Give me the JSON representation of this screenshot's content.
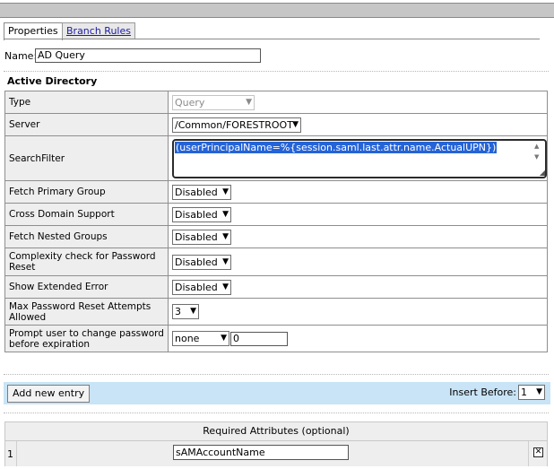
{
  "tabs": [
    {
      "label": "Properties"
    },
    {
      "label": "Branch Rules"
    }
  ],
  "name_label": "Name:",
  "name_value": "AD Query",
  "section_title": "Active Directory",
  "rows": {
    "type": {
      "label": "Type",
      "value": "Query"
    },
    "server": {
      "label": "Server",
      "value": "/Common/FORESTROOT"
    },
    "search_filter": {
      "label": "SearchFilter",
      "value": "(userPrincipalName=%{session.saml.last.attr.name.ActualUPN})"
    },
    "fetch_primary_group": {
      "label": "Fetch Primary Group",
      "value": "Disabled"
    },
    "cross_domain_support": {
      "label": "Cross Domain Support",
      "value": "Disabled"
    },
    "fetch_nested_groups": {
      "label": "Fetch Nested Groups",
      "value": "Disabled"
    },
    "complexity_check": {
      "label": "Complexity check for Password Reset",
      "value": "Disabled"
    },
    "show_extended_error": {
      "label": "Show Extended Error",
      "value": "Disabled"
    },
    "max_reset_attempts": {
      "label": "Max Password Reset Attempts Allowed",
      "value": "3"
    },
    "prompt_change": {
      "label": "Prompt user to change password before expiration",
      "value": "none",
      "days": "0"
    }
  },
  "action_bar": {
    "add_label": "Add new entry",
    "insert_before_label": "Insert Before:",
    "insert_before_value": "1"
  },
  "attributes": {
    "header": "Required Attributes (optional)",
    "rows": [
      {
        "num": "1",
        "value": "sAMAccountName"
      }
    ]
  }
}
